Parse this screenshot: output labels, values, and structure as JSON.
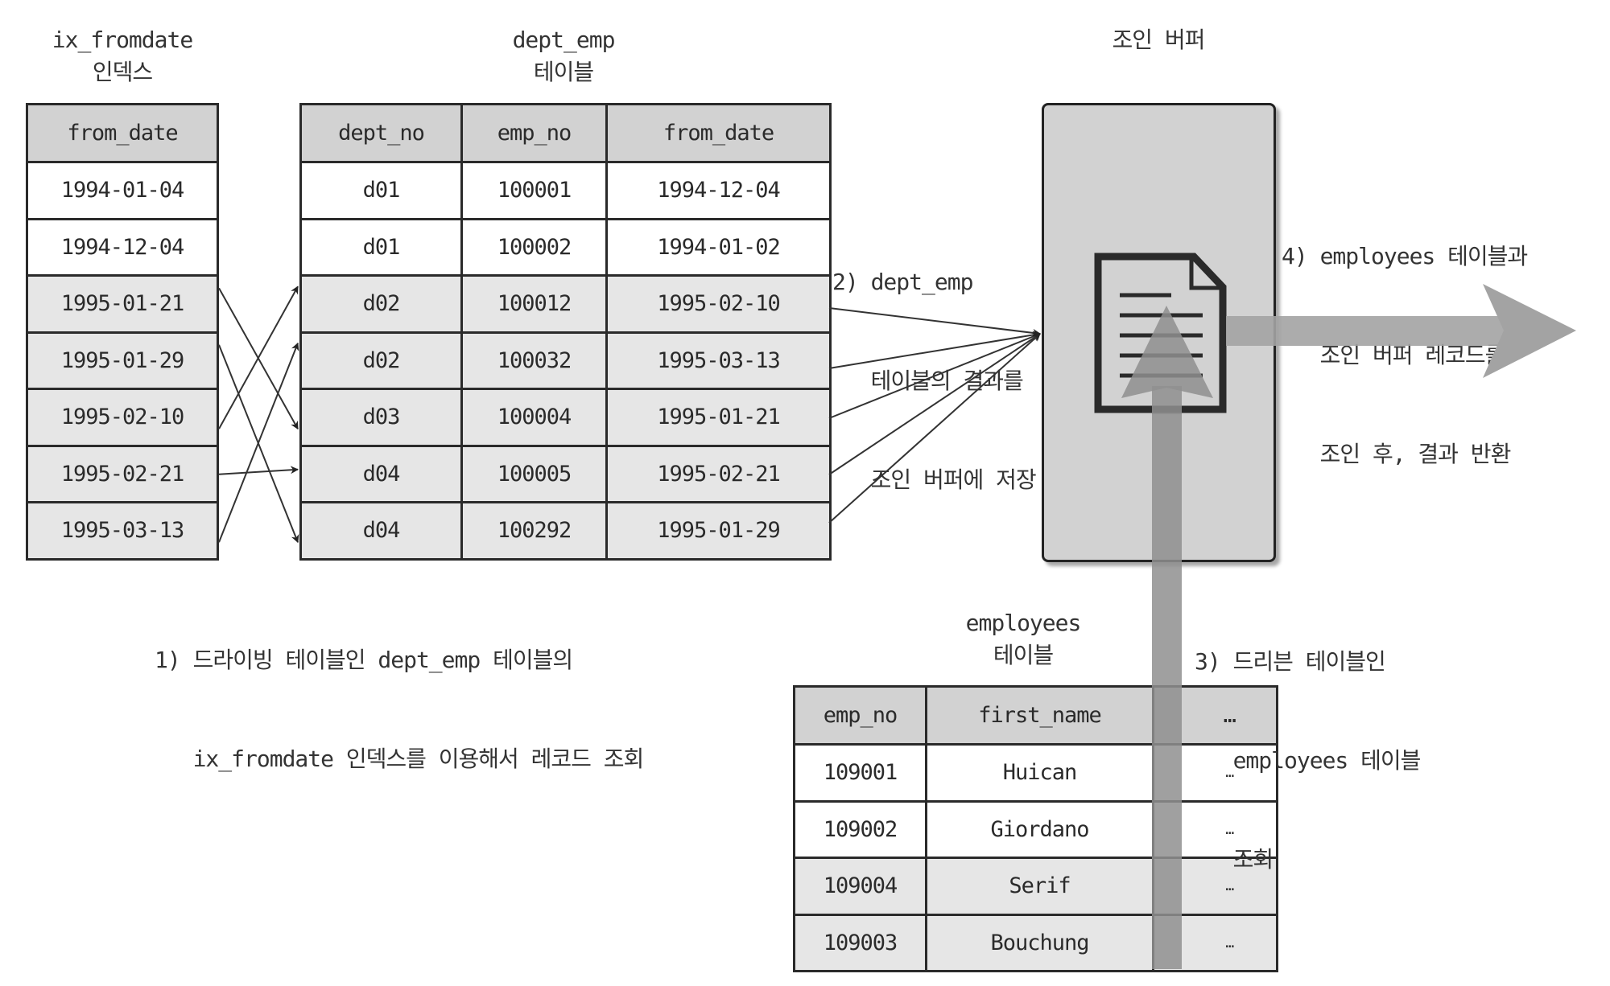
{
  "index_table": {
    "title_line1": "ix_fromdate",
    "title_line2": "인덱스",
    "columns": [
      "from_date"
    ],
    "rows": [
      {
        "from_date": "1994-01-04",
        "shade": "white"
      },
      {
        "from_date": "1994-12-04",
        "shade": "white"
      },
      {
        "from_date": "1995-01-21",
        "shade": "gray"
      },
      {
        "from_date": "1995-01-29",
        "shade": "gray"
      },
      {
        "from_date": "1995-02-10",
        "shade": "gray"
      },
      {
        "from_date": "1995-02-21",
        "shade": "gray"
      },
      {
        "from_date": "1995-03-13",
        "shade": "gray"
      }
    ]
  },
  "dept_emp_table": {
    "title_line1": "dept_emp",
    "title_line2": "테이블",
    "columns": [
      "dept_no",
      "emp_no",
      "from_date"
    ],
    "rows": [
      [
        "d01",
        "100001",
        "1994-12-04"
      ],
      [
        "d01",
        "100002",
        "1994-01-02"
      ],
      [
        "d02",
        "100012",
        "1995-02-10"
      ],
      [
        "d02",
        "100032",
        "1995-03-13"
      ],
      [
        "d03",
        "100004",
        "1995-01-21"
      ],
      [
        "d04",
        "100005",
        "1995-02-21"
      ],
      [
        "d04",
        "100292",
        "1995-01-29"
      ]
    ],
    "row_shades": [
      "white",
      "white",
      "gray",
      "gray",
      "gray",
      "gray",
      "gray"
    ]
  },
  "index_to_table_links": [
    {
      "from_index_row": 3,
      "to_table_row": 5
    },
    {
      "from_index_row": 4,
      "to_table_row": 7
    },
    {
      "from_index_row": 5,
      "to_table_row": 3
    },
    {
      "from_index_row": 6,
      "to_table_row": 6
    },
    {
      "from_index_row": 7,
      "to_table_row": 4
    }
  ],
  "table_to_buffer_links": [
    3,
    4,
    5,
    6,
    7
  ],
  "join_buffer": {
    "title": "조인 버퍼",
    "icon": "document-icon"
  },
  "employees_table": {
    "title_line1": "employees",
    "title_line2": "테이블",
    "columns": [
      "emp_no",
      "first_name",
      "",
      "…"
    ],
    "rows": [
      [
        "109001",
        "Huican",
        "",
        "…"
      ],
      [
        "109002",
        "Giordano",
        "",
        "…"
      ],
      [
        "109004",
        "Serif",
        "",
        "…"
      ],
      [
        "109003",
        "Bouchung",
        "",
        "…"
      ]
    ],
    "row_shades": [
      "white",
      "white",
      "gray",
      "gray"
    ]
  },
  "steps": {
    "step1": [
      "1) 드라이빙 테이블인 dept_emp 테이블의",
      "   ix_fromdate 인덱스를 이용해서 레코드 조회"
    ],
    "step2": [
      "2) dept_emp",
      "   테이블의 결과를",
      "   조인 버퍼에 저장"
    ],
    "step3": [
      "3) 드리븐 테이블인",
      "   employees 테이블",
      "   조회"
    ],
    "step4": [
      "4) employees 테이블과",
      "   조인 버퍼 레코드를",
      "   조인 후, 결과 반환"
    ]
  },
  "colors": {
    "header_fill": "#d2d2d2",
    "gray_row_fill": "#e6e6e6",
    "buffer_fill": "#d2d2d2",
    "flow_arrow": "#a3a3a3",
    "line": "#2a2a2a"
  }
}
